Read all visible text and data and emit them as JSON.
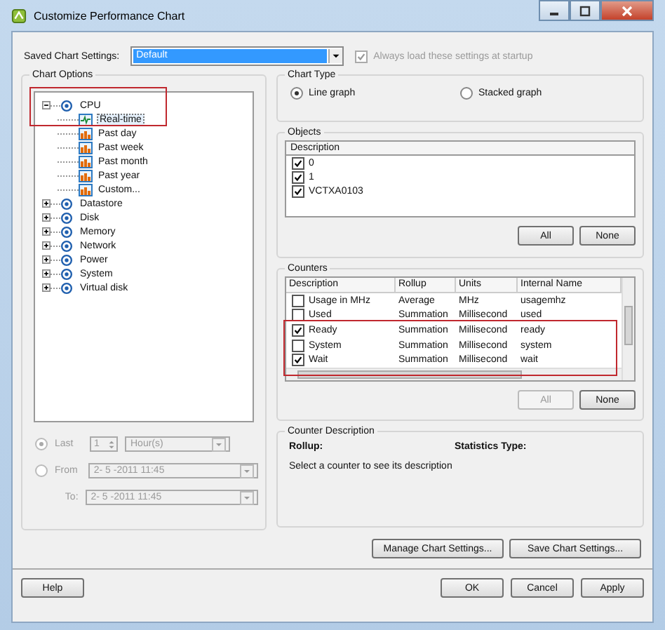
{
  "window": {
    "title": "Customize Performance Chart"
  },
  "saved_settings": {
    "label": "Saved Chart Settings:",
    "value": "Default",
    "always_load": {
      "label": "Always load these settings at startup",
      "checked": true,
      "disabled": true
    }
  },
  "chart_options": {
    "title": "Chart Options",
    "tree": [
      {
        "label": "CPU",
        "expanded": true,
        "children": [
          {
            "label": "Real-time",
            "kind": "realtime",
            "selected": true
          },
          {
            "label": "Past day",
            "kind": "history",
            "selected": false
          },
          {
            "label": "Past week",
            "kind": "history",
            "selected": false
          },
          {
            "label": "Past month",
            "kind": "history",
            "selected": false
          },
          {
            "label": "Past year",
            "kind": "history",
            "selected": false
          },
          {
            "label": "Custom...",
            "kind": "history",
            "selected": false
          }
        ]
      },
      {
        "label": "Datastore",
        "expanded": false
      },
      {
        "label": "Disk",
        "expanded": false
      },
      {
        "label": "Memory",
        "expanded": false
      },
      {
        "label": "Network",
        "expanded": false
      },
      {
        "label": "Power",
        "expanded": false
      },
      {
        "label": "System",
        "expanded": false
      },
      {
        "label": "Virtual disk",
        "expanded": false
      }
    ],
    "time_range": {
      "disabled": true,
      "last": {
        "label": "Last",
        "selected": true
      },
      "last_count": "1",
      "last_unit": "Hour(s)",
      "from": {
        "label": "From",
        "selected": false
      },
      "from_value": "2- 5 -2011 11:45",
      "to_label": "To:",
      "to_value": "2- 5 -2011 11:45"
    }
  },
  "chart_type": {
    "title": "Chart Type",
    "options": [
      {
        "label": "Line graph",
        "selected": true
      },
      {
        "label": "Stacked graph",
        "selected": false
      }
    ]
  },
  "objects": {
    "title": "Objects",
    "column": "Description",
    "rows": [
      {
        "label": "0",
        "checked": true
      },
      {
        "label": "1",
        "checked": true
      },
      {
        "label": "VCTXA0103",
        "checked": true
      }
    ],
    "buttons": [
      {
        "label": "All",
        "disabled": false
      },
      {
        "label": "None",
        "disabled": false
      }
    ]
  },
  "counters": {
    "title": "Counters",
    "columns": [
      "Description",
      "Rollup",
      "Units",
      "Internal Name"
    ],
    "rows": [
      {
        "cells": [
          "Usage in MHz",
          "Average",
          "MHz",
          "usagemhz"
        ],
        "checked": false
      },
      {
        "cells": [
          "Used",
          "Summation",
          "Millisecond",
          "used"
        ],
        "checked": false
      },
      {
        "cells": [
          "Ready",
          "Summation",
          "Millisecond",
          "ready"
        ],
        "checked": true
      },
      {
        "cells": [
          "System",
          "Summation",
          "Millisecond",
          "system"
        ],
        "checked": false
      },
      {
        "cells": [
          "Wait",
          "Summation",
          "Millisecond",
          "wait"
        ],
        "checked": true
      }
    ],
    "buttons": [
      {
        "label": "All",
        "disabled": true
      },
      {
        "label": "None",
        "disabled": false
      }
    ]
  },
  "counter_description": {
    "title": "Counter Description",
    "rollup_label": "Rollup:",
    "stats_label": "Statistics Type:",
    "hint": "Select a counter to see its description"
  },
  "settings_buttons": [
    "Manage Chart Settings...",
    "Save Chart Settings..."
  ],
  "footer": {
    "left": [
      "Help"
    ],
    "right": [
      "OK",
      "Cancel",
      "Apply"
    ]
  }
}
